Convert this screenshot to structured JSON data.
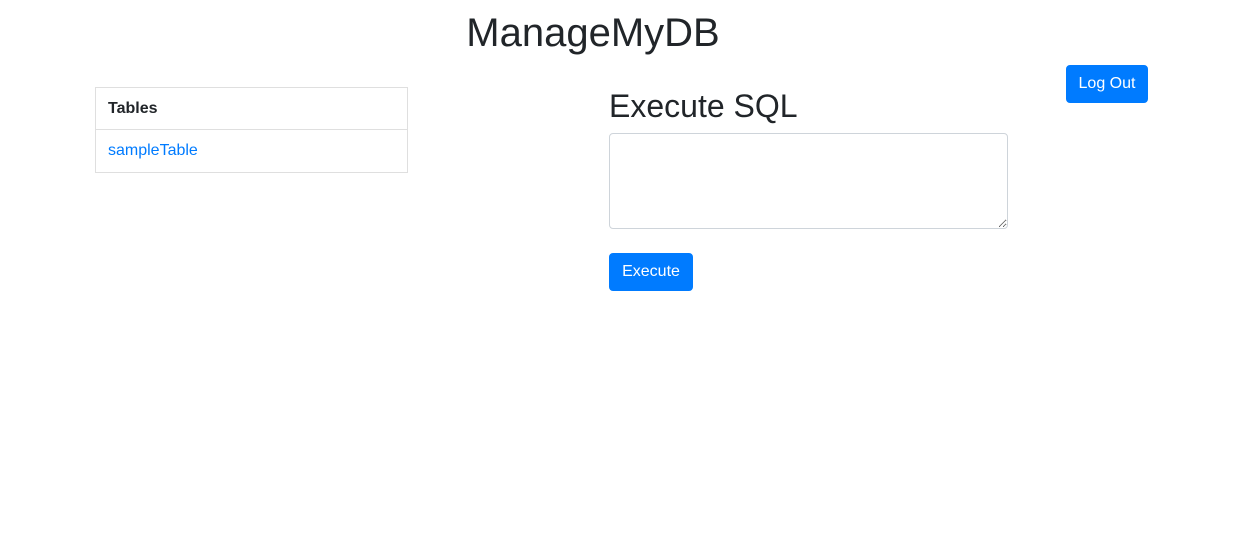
{
  "header": {
    "title": "ManageMyDB",
    "logout_label": "Log Out"
  },
  "tables_panel": {
    "header": "Tables",
    "items": [
      {
        "label": "sampleTable"
      }
    ]
  },
  "sql": {
    "heading": "Execute SQL",
    "input_value": "",
    "input_placeholder": "",
    "execute_label": "Execute"
  },
  "colors": {
    "accent": "#007bff",
    "text": "#212529",
    "border": "#dfdfdf"
  }
}
